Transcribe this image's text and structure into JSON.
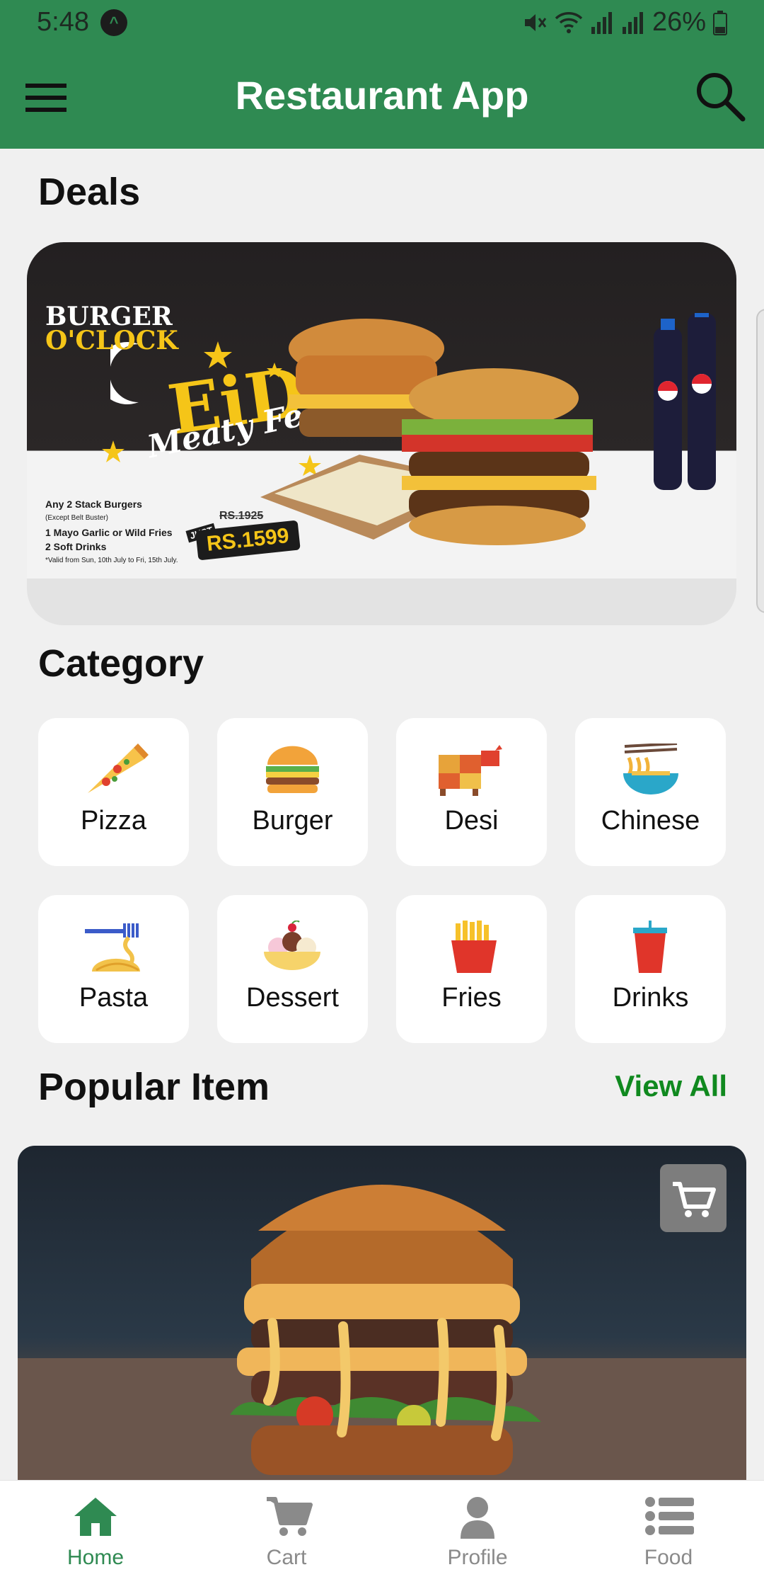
{
  "status_bar": {
    "time": "5:48",
    "battery": "26%",
    "app_icon_glyph": "^"
  },
  "app_bar": {
    "title": "Restaurant App",
    "menu_icon": "hamburger-menu-icon",
    "search_icon": "search-icon"
  },
  "deals": {
    "title": "Deals",
    "banner": {
      "brand_line1": "BURGER",
      "brand_line2": "O'CLOCK",
      "headline": "EiD",
      "subheadline": "Meaty Feast",
      "offer_lines": [
        "Any 2 Stack Burgers",
        "(Except Belt Buster)",
        "1 Mayo Garlic or Wild Fries",
        "2 Soft Drinks",
        "*Valid from Sun, 10th July to Fri, 15th July."
      ],
      "just_label": "JUST",
      "old_price": "RS.1925",
      "price": "RS.1599"
    }
  },
  "category": {
    "title": "Category",
    "items": [
      {
        "label": "Pizza",
        "icon": "pizza-icon"
      },
      {
        "label": "Burger",
        "icon": "burger-icon"
      },
      {
        "label": "Desi",
        "icon": "cow-icon"
      },
      {
        "label": "Chinese",
        "icon": "noodles-icon"
      },
      {
        "label": "Pasta",
        "icon": "pasta-fork-icon"
      },
      {
        "label": "Dessert",
        "icon": "sundae-icon"
      },
      {
        "label": "Fries",
        "icon": "fries-icon"
      },
      {
        "label": "Drinks",
        "icon": "drink-cup-icon"
      }
    ]
  },
  "popular": {
    "title": "Popular Item",
    "view_all": "View All",
    "cart_icon": "cart-icon"
  },
  "bottom_nav": {
    "active": "Home",
    "items": [
      {
        "label": "Home",
        "icon": "home-icon"
      },
      {
        "label": "Cart",
        "icon": "cart-icon"
      },
      {
        "label": "Profile",
        "icon": "profile-icon"
      },
      {
        "label": "Food",
        "icon": "list-icon"
      }
    ]
  },
  "colors": {
    "primary": "#2f8a52",
    "accent_text": "#10891f",
    "background": "#f0f0f0",
    "card": "#ffffff",
    "inactive_nav": "#8a8a8a"
  }
}
